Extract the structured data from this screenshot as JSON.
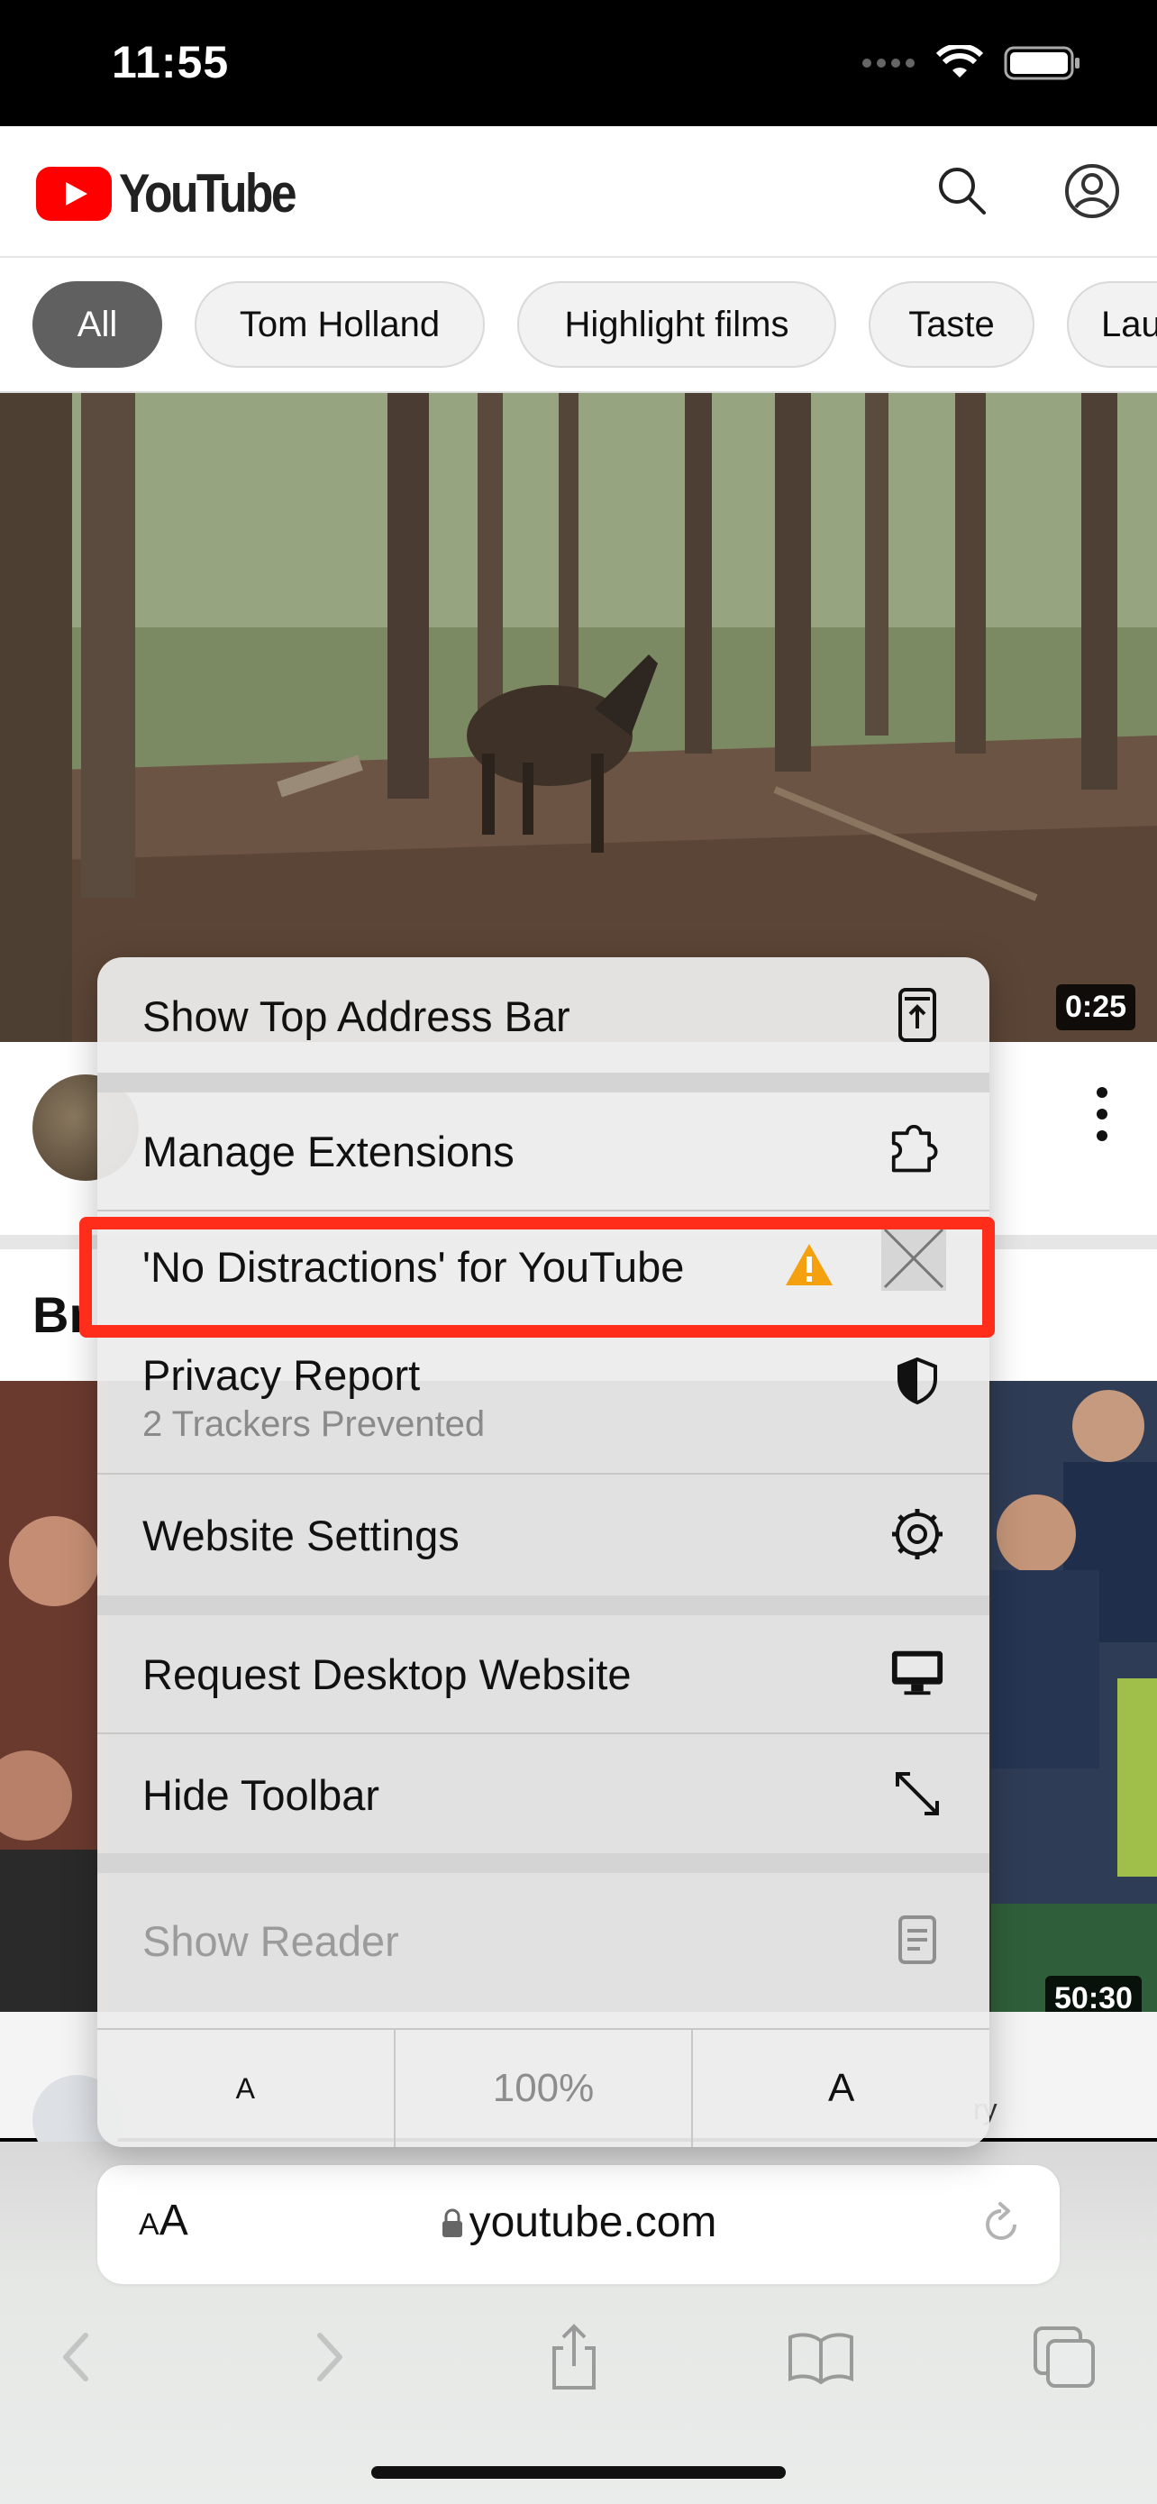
{
  "status": {
    "time": "11:55"
  },
  "youtube": {
    "brand": "YouTube",
    "chips": [
      "All",
      "Tom Holland",
      "Highlight films",
      "Taste",
      "Lau"
    ],
    "title_fragment": "Br",
    "video1_duration": "0:25",
    "video2_duration": "50:30",
    "meta_fragment": "ry"
  },
  "menu": {
    "show_top_address_bar": "Show Top Address Bar",
    "manage_extensions": "Manage Extensions",
    "extension_name": "'No Distractions' for YouTube",
    "privacy_report": "Privacy Report",
    "privacy_sub": "2 Trackers Prevented",
    "website_settings": "Website Settings",
    "request_desktop": "Request Desktop Website",
    "hide_toolbar": "Hide Toolbar",
    "show_reader": "Show Reader",
    "zoom_small": "A",
    "zoom_level": "100%",
    "zoom_large": "A"
  },
  "address_bar": {
    "aa_small": "A",
    "aa_large": "A",
    "url": "youtube.com"
  },
  "colors": {
    "highlight": "#ff2d1a",
    "warning": "#f5a00f",
    "yt_red": "#ff0000"
  },
  "icons": [
    "wifi-icon",
    "battery-icon",
    "search-icon",
    "account-icon",
    "more-icon",
    "arrow-up-rectangle-icon",
    "puzzle-icon",
    "warning-icon",
    "close-icon",
    "shield-icon",
    "gear-icon",
    "desktop-icon",
    "expand-arrows-icon",
    "reader-icon",
    "lock-icon",
    "reload-icon",
    "back-icon",
    "forward-icon",
    "share-icon",
    "book-icon",
    "tabs-icon"
  ]
}
